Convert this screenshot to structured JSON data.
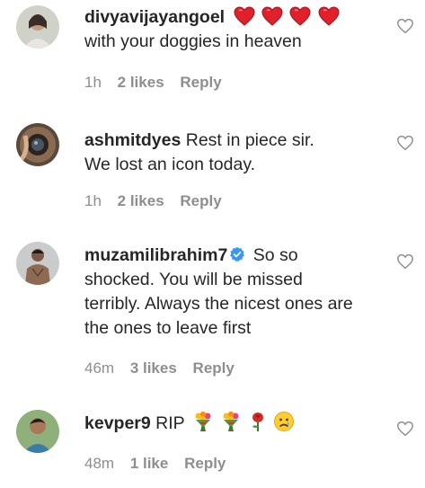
{
  "comments": [
    {
      "username": "divyavijayangoel",
      "text_line1": "",
      "text_line2": "with your doggies in heaven",
      "emoji": [
        "red-heart",
        "red-heart",
        "red-heart",
        "red-heart"
      ],
      "time": "1h",
      "likes": "2 likes",
      "reply": "Reply"
    },
    {
      "username": "ashmitdyes",
      "text_line1": "Rest in piece sir.",
      "text_line2": "We lost an icon today.",
      "time": "1h",
      "likes": "2 likes",
      "reply": "Reply"
    },
    {
      "username": "muzamilibrahim7",
      "verified": true,
      "text_line1": "So so",
      "text_line2": "shocked. You will be missed",
      "text_line3": "terribly. Always the nicest ones are",
      "text_line4": "the ones to leave first",
      "time": "46m",
      "likes": "3 likes",
      "reply": "Reply"
    },
    {
      "username": "kevper9",
      "text_line1": "RIP",
      "emoji": [
        "bouquet",
        "bouquet",
        "rose",
        "sad-face"
      ],
      "time": "48m",
      "likes": "1 like",
      "reply": "Reply"
    }
  ],
  "colors": {
    "text": "#262626",
    "meta": "#8e8e8e",
    "heart_emoji": "#e0202b",
    "verified": "#3897f0"
  },
  "icons": {
    "like": "heart-outline-icon",
    "verified": "verified-badge-icon"
  }
}
